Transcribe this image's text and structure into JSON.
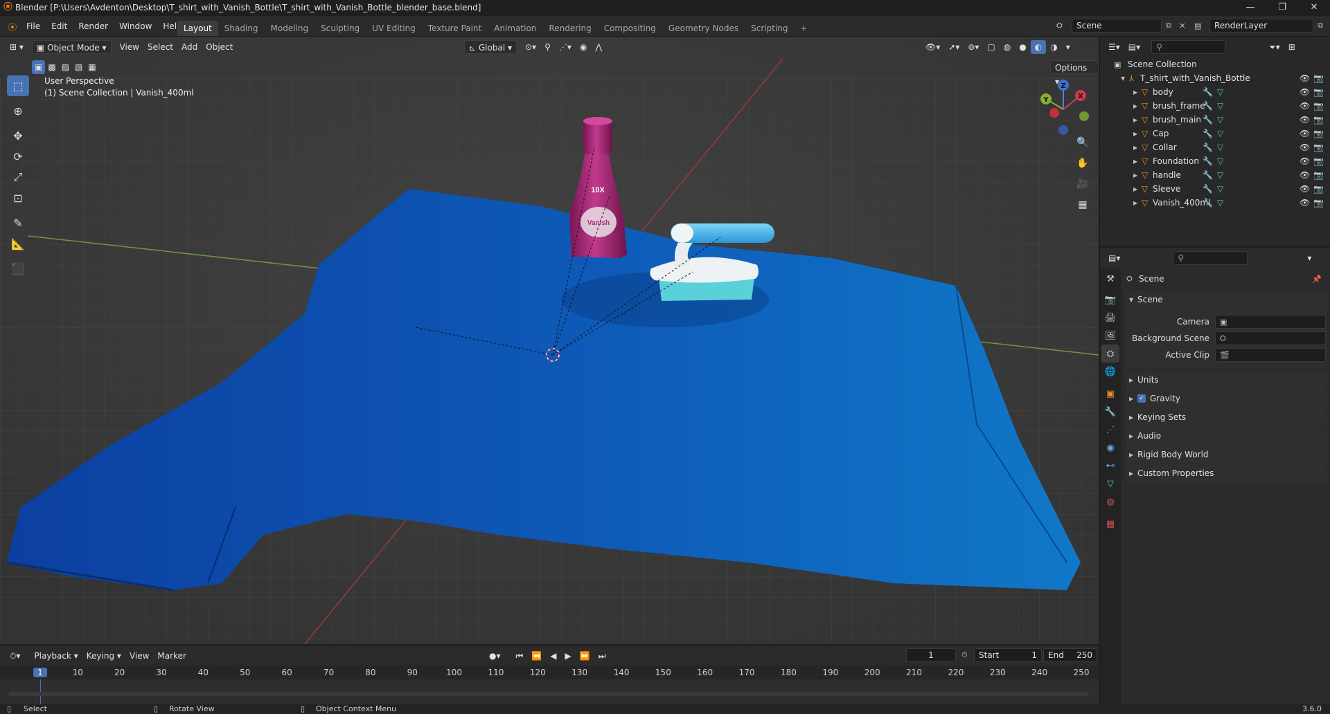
{
  "window": {
    "title": "Blender [P:\\Users\\Avdenton\\Desktop\\T_shirt_with_Vanish_Bottle\\T_shirt_with_Vanish_Bottle_blender_base.blend]",
    "minimize": "—",
    "maximize": "❐",
    "close": "✕"
  },
  "menu": [
    "File",
    "Edit",
    "Render",
    "Window",
    "Help"
  ],
  "workspaces": [
    "Layout",
    "Shading",
    "Modeling",
    "Sculpting",
    "UV Editing",
    "Texture Paint",
    "Animation",
    "Rendering",
    "Compositing",
    "Geometry Nodes",
    "Scripting",
    "+"
  ],
  "scene_field": "Scene",
  "renderlayer_field": "RenderLayer",
  "viewport": {
    "mode": "Object Mode",
    "menus": [
      "View",
      "Select",
      "Add",
      "Object"
    ],
    "orientation": "Global",
    "options": "Options",
    "perspective": "User Perspective",
    "collection_info": "(1) Scene Collection | Vanish_400ml",
    "gizmo": {
      "x": "X",
      "y": "Y",
      "z": "Z"
    },
    "bottle_text": {
      "power": "10X",
      "brand": "Vanish"
    }
  },
  "outliner": {
    "root": "Scene Collection",
    "collection": "T_shirt_with_Vanish_Bottle",
    "objects": [
      "body",
      "brush_frame",
      "brush_main",
      "Cap",
      "Collar",
      "Foundation",
      "handle",
      "Sleeve",
      "Vanish_400ml"
    ]
  },
  "properties": {
    "header": "Scene",
    "section": "Scene",
    "rows": [
      {
        "label": "Camera"
      },
      {
        "label": "Background Scene"
      },
      {
        "label": "Active Clip"
      }
    ],
    "panels": [
      "Units",
      "Gravity",
      "Keying Sets",
      "Audio",
      "Rigid Body World",
      "Custom Properties"
    ],
    "gravity_checked": true
  },
  "timeline": {
    "menus": [
      "Playback",
      "Keying",
      "View",
      "Marker"
    ],
    "current_frame": "1",
    "start_label": "Start",
    "start": "1",
    "end_label": "End",
    "end": "250",
    "ticks": [
      "1",
      "10",
      "20",
      "30",
      "40",
      "50",
      "60",
      "70",
      "80",
      "90",
      "100",
      "110",
      "120",
      "130",
      "140",
      "150",
      "160",
      "170",
      "180",
      "190",
      "200",
      "210",
      "220",
      "230",
      "240",
      "250"
    ]
  },
  "status": {
    "select": "Select",
    "rotate": "Rotate View",
    "context": "Object Context Menu",
    "version": "3.6.0"
  },
  "colors": {
    "accent": "#4772b3",
    "mesh": "#e8902a",
    "shirt": "#1565c0",
    "bottle": "#b0287a"
  }
}
